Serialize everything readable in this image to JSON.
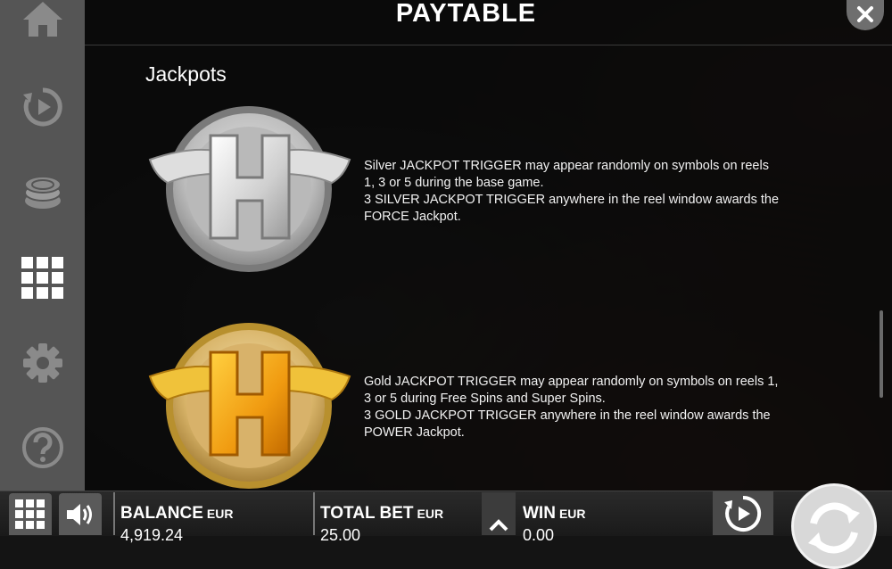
{
  "header": {
    "title": "PAYTABLE"
  },
  "sidebar": {
    "items": [
      {
        "icon": "home-icon"
      },
      {
        "icon": "replay-icon"
      },
      {
        "icon": "coins-icon"
      },
      {
        "icon": "grid-menu-icon"
      },
      {
        "icon": "gear-icon"
      },
      {
        "icon": "help-icon"
      }
    ]
  },
  "paytable": {
    "section_title": "Jackpots",
    "silver": {
      "symbol": "silver-h-jackpot-icon",
      "lines": [
        "Silver JACKPOT TRIGGER may appear randomly on symbols on reels 1, 3 or 5 during the base game.",
        "3 SILVER JACKPOT TRIGGER anywhere in the reel window awards the FORCE Jackpot."
      ]
    },
    "gold": {
      "symbol": "gold-h-jackpot-icon",
      "lines": [
        "Gold JACKPOT TRIGGER may appear randomly on symbols on reels 1, 3 or 5 during Free Spins and Super Spins.",
        "3 GOLD JACKPOT TRIGGER anywhere in the reel window awards the POWER Jackpot."
      ]
    }
  },
  "bottom_bar": {
    "balance": {
      "label": "BALANCE",
      "currency": "EUR",
      "value": "4,919.24"
    },
    "total_bet": {
      "label": "TOTAL BET",
      "currency": "EUR",
      "value": "25.00"
    },
    "win": {
      "label": "WIN",
      "currency": "EUR",
      "value": "0.00"
    }
  },
  "colors": {
    "sidebar": "#555555",
    "panel": "#0a0a0a",
    "silver": "#c8c8c8",
    "gold": "#f0a020"
  }
}
